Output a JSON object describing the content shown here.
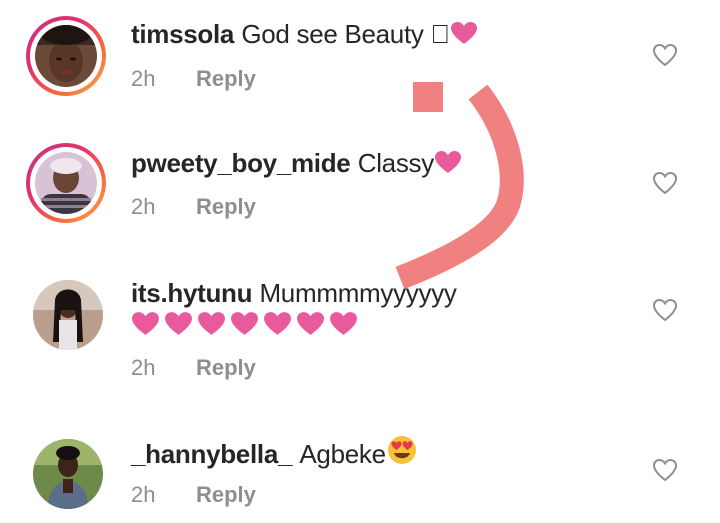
{
  "comments": [
    {
      "username": "timssola",
      "text": "God see Beauty \u0000",
      "emoji_after": "heart",
      "time": "2h",
      "reply_label": "Reply"
    },
    {
      "username": "pweety_boy_mide",
      "text": "Classy",
      "emoji_after": "heart",
      "time": "2h",
      "reply_label": "Reply"
    },
    {
      "username": "its.hytunu",
      "text": "Mummmmyyyyyy",
      "hearts_count": 7,
      "time": "2h",
      "reply_label": "Reply"
    },
    {
      "username": "_hannybella_",
      "text": "Agbeke",
      "emoji_after": "heart-eyes-face",
      "time": "2h",
      "reply_label": "Reply"
    }
  ],
  "icons": {
    "like": "heart-outline-icon",
    "emoji_heart": "pink-heart-emoji"
  },
  "colors": {
    "username": "#262626",
    "meta": "#8e8e8e",
    "pink_heart": "#e85a9c",
    "story_ring": [
      "#c13584",
      "#e1306c",
      "#f56040",
      "#fcaf45"
    ],
    "overlay_mark": "#f07a7a"
  }
}
